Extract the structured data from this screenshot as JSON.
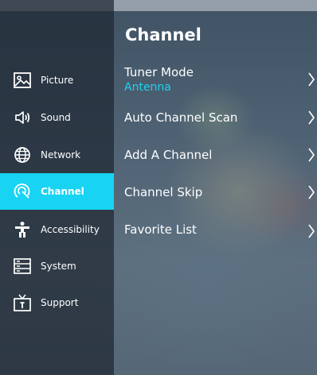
{
  "sidebar": {
    "items": [
      {
        "label": "Picture",
        "icon": "picture-icon"
      },
      {
        "label": "Sound",
        "icon": "sound-icon"
      },
      {
        "label": "Network",
        "icon": "globe-icon"
      },
      {
        "label": "Channel",
        "icon": "channel-icon",
        "active": true
      },
      {
        "label": "Accessibility",
        "icon": "accessibility-icon"
      },
      {
        "label": "System",
        "icon": "system-icon"
      },
      {
        "label": "Support",
        "icon": "support-icon"
      }
    ]
  },
  "panel": {
    "title": "Channel",
    "items": [
      {
        "label": "Tuner Mode",
        "value": "Antenna"
      },
      {
        "label": "Auto Channel Scan"
      },
      {
        "label": "Add A Channel"
      },
      {
        "label": "Channel Skip"
      },
      {
        "label": "Favorite List"
      }
    ]
  },
  "colors": {
    "accent": "#18d4f2",
    "sidebar_bg": "#26303c",
    "text": "#ffffff"
  }
}
